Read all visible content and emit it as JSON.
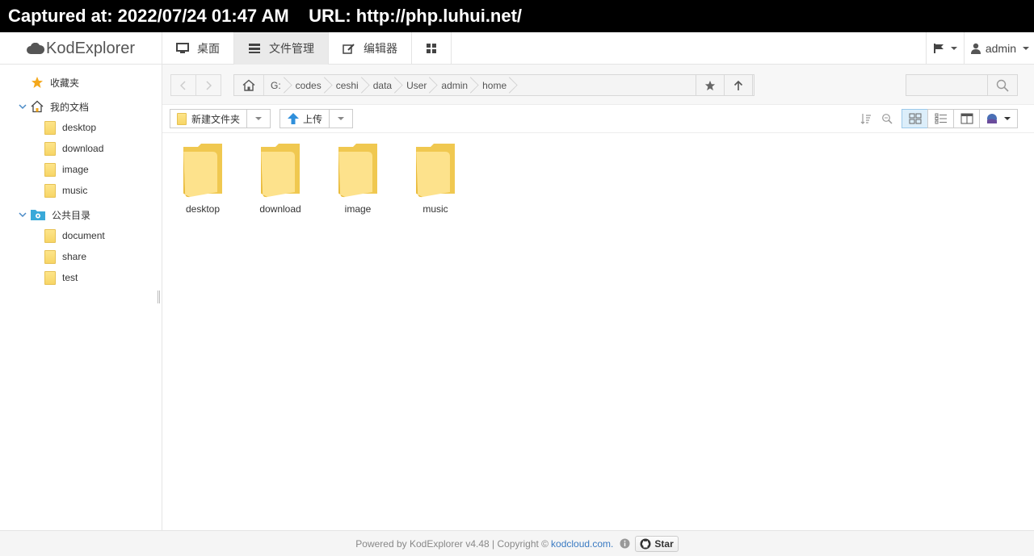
{
  "capture": {
    "text": "Captured at: 2022/07/24 01:47 AM    URL: http://php.luhui.net/"
  },
  "app": {
    "name": "KodExplorer"
  },
  "nav": {
    "tabs": [
      {
        "label": "桌面",
        "icon": "monitor-icon"
      },
      {
        "label": "文件管理",
        "icon": "file-manager-icon"
      },
      {
        "label": "编辑器",
        "icon": "edit-icon"
      }
    ],
    "user": "admin"
  },
  "sidebar": {
    "favorites": "收藏夹",
    "my_docs": "我的文档",
    "my_docs_items": [
      "desktop",
      "download",
      "image",
      "music"
    ],
    "public": "公共目录",
    "public_items": [
      "document",
      "share",
      "test"
    ]
  },
  "path": {
    "segments": [
      "G:",
      "codes",
      "ceshi",
      "data",
      "User",
      "admin",
      "home"
    ]
  },
  "toolbar": {
    "new_folder": "新建文件夹",
    "upload": "上传"
  },
  "files": [
    "desktop",
    "download",
    "image",
    "music"
  ],
  "footer": {
    "text": "Powered by KodExplorer v4.48 | Copyright ©",
    "link": "kodcloud.com.",
    "star": "Star"
  },
  "colors": {
    "folder": "#f7d566",
    "accent": "#3a7ac2",
    "star": "#f4a81c"
  }
}
